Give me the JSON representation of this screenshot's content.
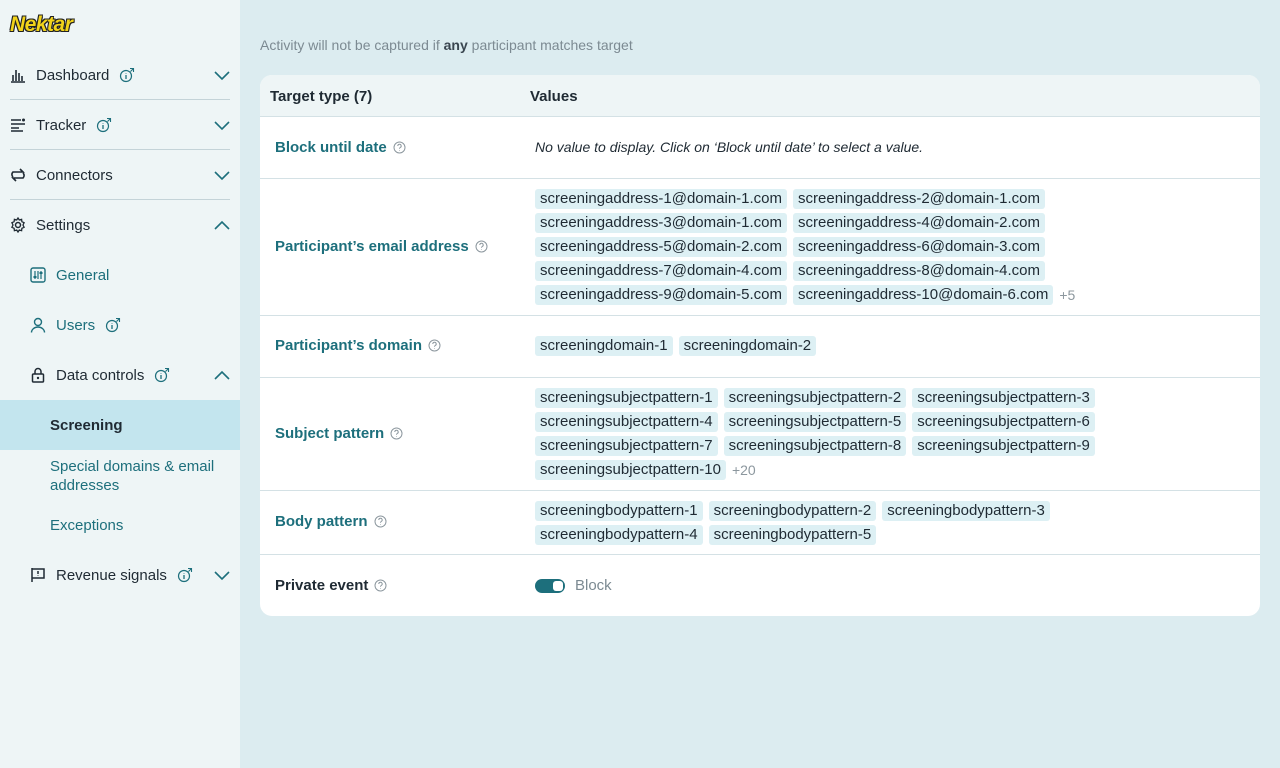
{
  "logo": "Nektar",
  "sidebar": {
    "dashboard": "Dashboard",
    "tracker": "Tracker",
    "connectors": "Connectors",
    "settings": "Settings",
    "general": "General",
    "users": "Users",
    "data_controls": "Data controls",
    "screening": "Screening",
    "special_domains": "Special domains & email addresses",
    "exceptions": "Exceptions",
    "revenue_signals": "Revenue signals"
  },
  "caption": {
    "prefix": "Activity will not be captured if ",
    "emphasis": "any",
    "suffix": " participant matches target"
  },
  "table": {
    "col_target": "Target type (7)",
    "col_values": "Values",
    "block_until_date": {
      "label": "Block until date",
      "empty": "No value to display. Click on ‘Block until date’ to select a value."
    },
    "emails": {
      "label": "Participant’s email address",
      "values": [
        "screeningaddress-1@domain-1.com",
        "screeningaddress-2@domain-1.com",
        "screeningaddress-3@domain-1.com",
        "screeningaddress-4@domain-2.com",
        "screeningaddress-5@domain-2.com",
        "screeningaddress-6@domain-3.com",
        "screeningaddress-7@domain-4.com",
        "screeningaddress-8@domain-4.com",
        "screeningaddress-9@domain-5.com",
        "screeningaddress-10@domain-6.com"
      ],
      "more": "+5"
    },
    "domains": {
      "label": "Participant’s domain",
      "values": [
        "screeningdomain-1",
        "screeningdomain-2"
      ]
    },
    "subjects": {
      "label": "Subject pattern",
      "values": [
        "screeningsubjectpattern-1",
        "screeningsubjectpattern-2",
        "screeningsubjectpattern-3",
        "screeningsubjectpattern-4",
        "screeningsubjectpattern-5",
        "screeningsubjectpattern-6",
        "screeningsubjectpattern-7",
        "screeningsubjectpattern-8",
        "screeningsubjectpattern-9",
        "screeningsubjectpattern-10"
      ],
      "more": "+20"
    },
    "bodies": {
      "label": "Body pattern",
      "values": [
        "screeningbodypattern-1",
        "screeningbodypattern-2",
        "screeningbodypattern-3",
        "screeningbodypattern-4",
        "screeningbodypattern-5"
      ]
    },
    "private_event": {
      "label": "Private event",
      "toggle_label": "Block",
      "enabled": true
    }
  },
  "icons": {
    "dashboard": "bar-chart-icon",
    "tracker": "list-icon",
    "connectors": "sync-icon",
    "settings": "gear-icon",
    "general": "sliders-icon",
    "users": "user-icon",
    "data_controls": "lock-icon",
    "revenue_signals": "flag-icon",
    "info": "info-icon",
    "help": "question-icon"
  },
  "colors": {
    "accent": "#1d6f7c",
    "active_bg": "#c3e5ee",
    "chip_bg": "#ddf0f4",
    "logo": "#f2d31a"
  }
}
